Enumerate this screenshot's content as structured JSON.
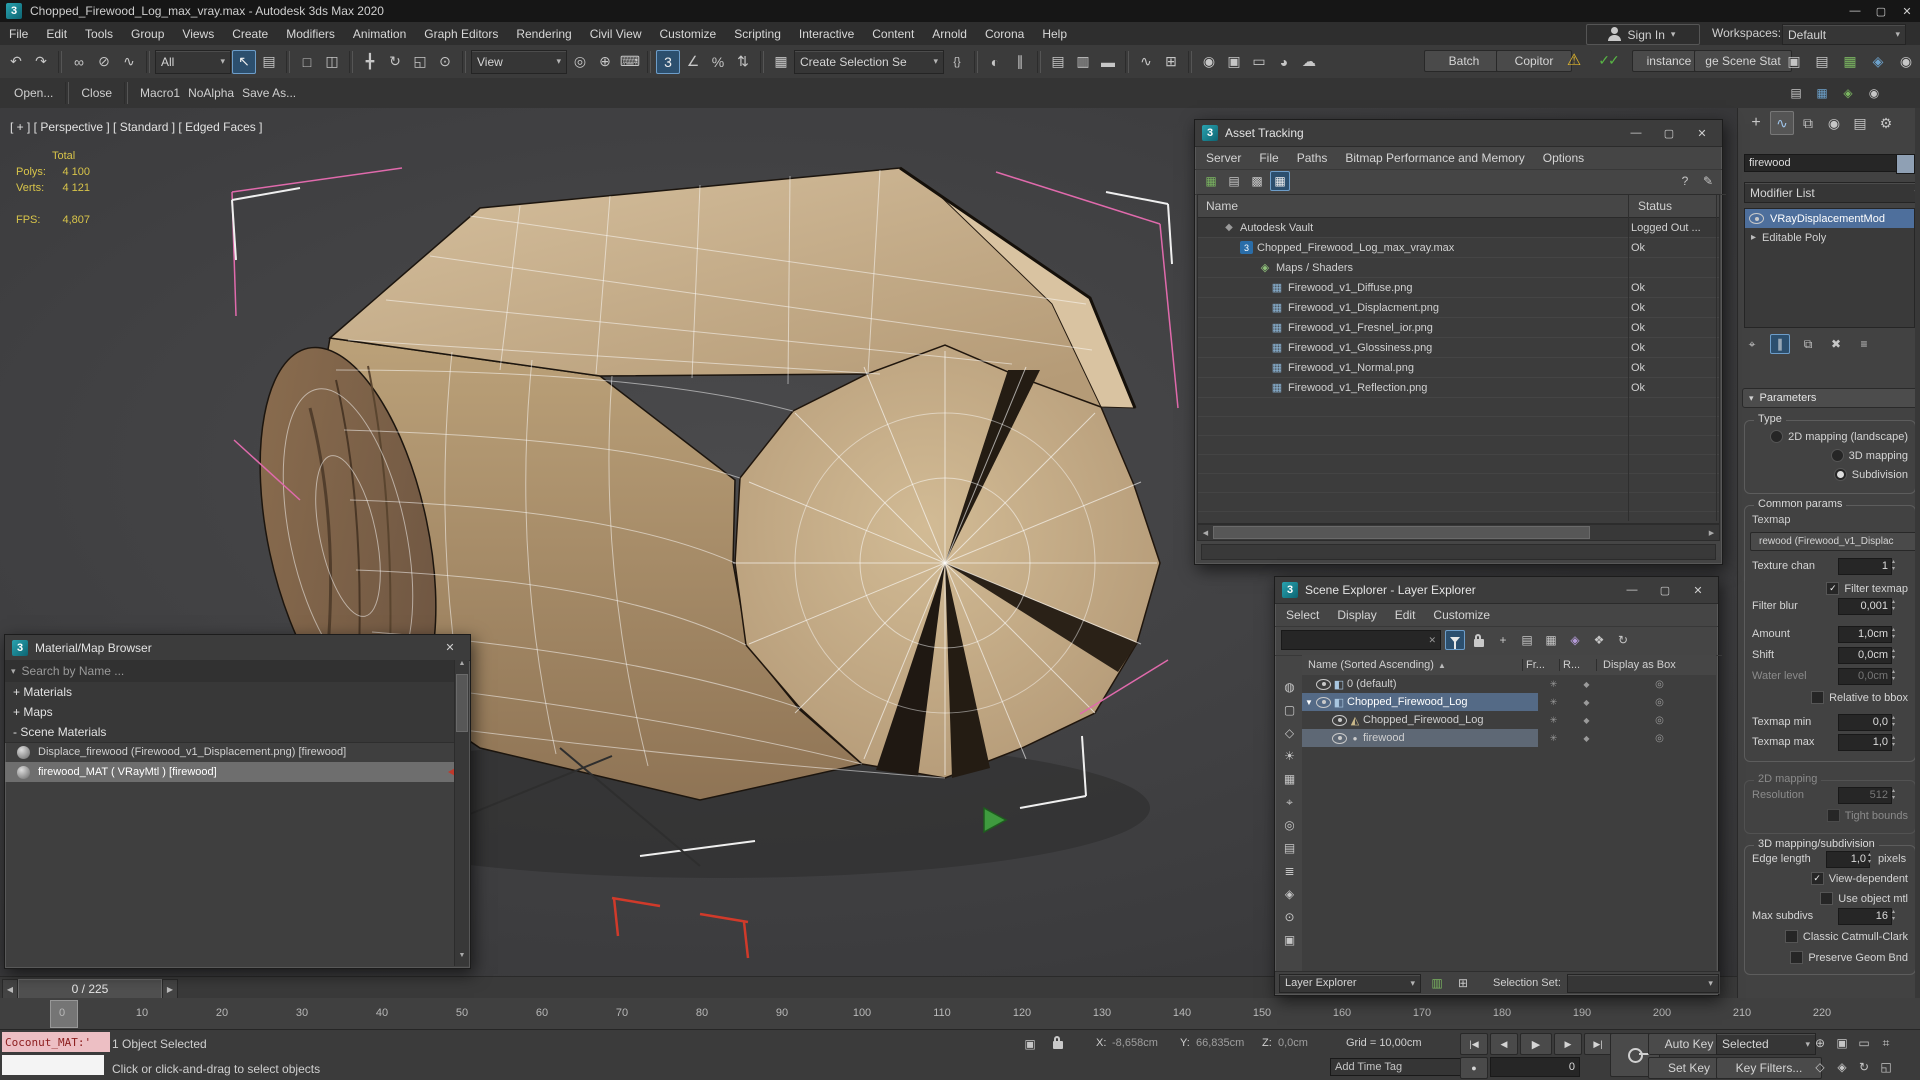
{
  "titlebar": {
    "title": "Chopped_Firewood_Log_max_vray.max - Autodesk 3ds Max 2020"
  },
  "menus": [
    "File",
    "Edit",
    "Tools",
    "Group",
    "Views",
    "Create",
    "Modifiers",
    "Animation",
    "Graph Editors",
    "Rendering",
    "Civil View",
    "Customize",
    "Scripting",
    "Interactive",
    "Content",
    "Arnold",
    "Corona",
    "Help"
  ],
  "account": {
    "sign_in": "Sign In",
    "workspaces_label": "Workspaces:",
    "workspace": "Default"
  },
  "toolbar": {
    "filter": "All",
    "coord": "View",
    "named_sel": "Create Selection Se",
    "batch": "Batch",
    "copitor": "Copitor",
    "instance": "instance",
    "scene_states": "ge Scene Stat"
  },
  "quick": {
    "open": "Open...",
    "close": "Close",
    "macro": "Macro1",
    "noalpha": "NoAlpha",
    "saveas": "Save As..."
  },
  "viewport": {
    "label": "[ + ] [ Perspective ] [ Standard ] [ Edged Faces ]",
    "stats": {
      "total": "Total",
      "polys_label": "Polys:",
      "polys": "4 100",
      "verts_label": "Verts:",
      "verts": "4 121",
      "fps_label": "FPS:",
      "fps": "4,807"
    }
  },
  "asset": {
    "title": "Asset Tracking",
    "menus": [
      "Server",
      "File",
      "Paths",
      "Bitmap Performance and Memory",
      "Options"
    ],
    "cols": {
      "name": "Name",
      "status": "Status"
    },
    "rows": [
      {
        "name": "Autodesk Vault",
        "status": "Logged Out ..."
      },
      {
        "name": "Chopped_Firewood_Log_max_vray.max",
        "status": "Ok"
      },
      {
        "name": "Maps / Shaders",
        "status": ""
      },
      {
        "name": "Firewood_v1_Diffuse.png",
        "status": "Ok"
      },
      {
        "name": "Firewood_v1_Displacment.png",
        "status": "Ok"
      },
      {
        "name": "Firewood_v1_Fresnel_ior.png",
        "status": "Ok"
      },
      {
        "name": "Firewood_v1_Glossiness.png",
        "status": "Ok"
      },
      {
        "name": "Firewood_v1_Normal.png",
        "status": "Ok"
      },
      {
        "name": "Firewood_v1_Reflection.png",
        "status": "Ok"
      }
    ]
  },
  "explorer": {
    "title": "Scene Explorer - Layer Explorer",
    "menus": [
      "Select",
      "Display",
      "Edit",
      "Customize"
    ],
    "header": "Name (Sorted Ascending)",
    "cols": {
      "fr": "Fr...",
      "r": "R...",
      "box": "Display as Box"
    },
    "rows": [
      {
        "name": "0 (default)"
      },
      {
        "name": "Chopped_Firewood_Log"
      },
      {
        "name": "Chopped_Firewood_Log"
      },
      {
        "name": "firewood"
      }
    ],
    "bottom": {
      "mode": "Layer Explorer",
      "selection_set_label": "Selection Set:"
    }
  },
  "mat": {
    "title": "Material/Map Browser",
    "search": "Search by Name ...",
    "groups": [
      "+ Materials",
      "+ Maps",
      "- Scene Materials"
    ],
    "rows": [
      "Displace_firewood (Firewood_v1_Displacement.png) [firewood]",
      "firewood_MAT ( VRayMtl ) [firewood]"
    ]
  },
  "panel": {
    "object_name": "firewood",
    "modifier_list": "Modifier List",
    "stack": [
      "VRayDisplacementMod",
      "Editable Poly"
    ],
    "params": "Parameters",
    "type": {
      "label": "Type",
      "opt1": "2D mapping (landscape)",
      "opt2": "3D mapping",
      "opt3": "Subdivision"
    },
    "common": {
      "label": "Common params",
      "texmap": "Texmap",
      "texmap_btn": "rewood (Firewood_v1_Displac",
      "texchan_label": "Texture chan",
      "texchan": "1",
      "filter_texmap": "Filter texmap",
      "filterblur_label": "Filter blur",
      "filterblur": "0,001",
      "amount_label": "Amount",
      "amount": "1,0cm",
      "shift_label": "Shift",
      "shift": "0,0cm",
      "water_label": "Water level",
      "water": "0,0cm",
      "relative": "Relative to bbox",
      "tmin_label": "Texmap min",
      "tmin": "0,0",
      "tmax_label": "Texmap max",
      "tmax": "1,0"
    },
    "m2d": {
      "label": "2D mapping",
      "res_label": "Resolution",
      "res": "512",
      "tight": "Tight bounds"
    },
    "m3d": {
      "label": "3D mapping/subdivision",
      "edge_label": "Edge length",
      "edge": "1,0",
      "edge_unit": "pixels",
      "viewdep": "View-dependent",
      "useobj": "Use object mtl",
      "maxsub_label": "Max subdivs",
      "maxsub": "16",
      "catmull": "Classic Catmull-Clark",
      "preserve": "Preserve Geom Bnd"
    }
  },
  "timeline": {
    "slider": "0 / 225",
    "ticks": [
      "0",
      "10",
      "20",
      "30",
      "40",
      "50",
      "60",
      "70",
      "80",
      "90",
      "100",
      "110",
      "120",
      "130",
      "140",
      "150",
      "160",
      "170",
      "180",
      "190",
      "200",
      "210",
      "220"
    ]
  },
  "status": {
    "listener": "Coconut_MAT:'",
    "selected": "1 Object Selected",
    "prompt": "Click or click-and-drag to select objects",
    "x_label": "X:",
    "x": "-8,658cm",
    "y_label": "Y:",
    "y": "66,835cm",
    "z_label": "Z:",
    "z": "0,0cm",
    "grid": "Grid = 10,00cm",
    "time_tag": "Add Time Tag",
    "auto_key": "Auto Key",
    "set_key": "Set Key",
    "key_mode": "Selected",
    "key_filters": "Key Filters...",
    "frame": "0"
  },
  "icons": {
    "app": "3",
    "min": "—",
    "max": "▢",
    "close": "✕",
    "caret": "▾",
    "caret_up": "▴",
    "asc": "▲",
    "expand": "▼",
    "collapsed": "▸",
    "undo": "↶",
    "redo": "↷",
    "link": "∞",
    "unlink": "⊘",
    "bind": "∿",
    "select": "↖",
    "byname": "▤",
    "region": "□",
    "wincross": "◫",
    "move": "╋",
    "rotate": "↻",
    "scale": "◱",
    "place": "⊙",
    "pivot": "◎",
    "manip": "⊕",
    "kbd": "⌨",
    "snap": "3",
    "angle": "∠",
    "pct": "%",
    "spinsnap": "⇅",
    "sets": "▦",
    "braces": "{}",
    "mirror": "◐",
    "align": "∥",
    "sexp": "▤",
    "lexp": "▥",
    "ribbon": "▬",
    "curve": "∿",
    "schem": "⊞",
    "mtl": "◉",
    "rset": "▣",
    "rfrm": "▭",
    "rend": "◕",
    "cloud": "☁",
    "warn": "⚠",
    "checks": "✓✓",
    "tbl": [
      "▦",
      "▤",
      "▩",
      "▦"
    ],
    "help": "?",
    "edit": "✎",
    "vault": "◆",
    "maxfile": "3",
    "shader": "◈",
    "img": "▦",
    "layer": "◧",
    "geom": "◭",
    "sphere": "●",
    "fr": "✳",
    "rcol": "◆",
    "boxcol": "◎",
    "strip": [
      "◍",
      "▢",
      "◇",
      "☀",
      "▦",
      "⌖",
      "◎",
      "▤",
      "≣",
      "◈",
      "⊙",
      "▣"
    ],
    "exp_tools": [
      "+",
      "▤",
      "▦",
      "◈",
      "❖",
      "↻"
    ],
    "tabs": [
      "+",
      "∿",
      "⧉",
      "◉",
      "▤",
      "⚙"
    ],
    "stacktools": [
      "⌖",
      "∥",
      "⧉",
      "✖",
      "≡"
    ],
    "extra": [
      "▣",
      "▤",
      "▦",
      "◈",
      "◉"
    ],
    "nav": [
      "⊕",
      "▣",
      "▭",
      "⌗",
      "◇",
      "◈",
      "↻",
      "◱"
    ],
    "prev_end": "|◀",
    "prev": "◀",
    "play": "▶",
    "next": "▶",
    "next_end": "▶|",
    "left": "◀",
    "right": "▶",
    "up": "▲",
    "down": "▼",
    "search_clear": "✕",
    "dot": "●"
  }
}
